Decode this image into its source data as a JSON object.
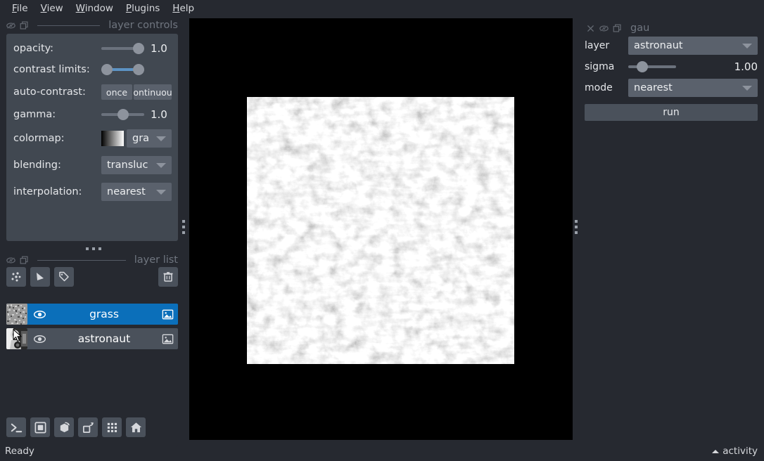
{
  "app": {
    "status": "Ready",
    "activity_label": "activity",
    "accent_selected": "#0b6fba",
    "panel_bg": "#414851",
    "window_bg": "#262930",
    "slider_fill": "#5c93c4"
  },
  "menubar": {
    "items": [
      {
        "label": "File",
        "mnemonic": "F"
      },
      {
        "label": "View",
        "mnemonic": "V"
      },
      {
        "label": "Window",
        "mnemonic": "W"
      },
      {
        "label": "Plugins",
        "mnemonic": "P"
      },
      {
        "label": "Help",
        "mnemonic": "H"
      }
    ]
  },
  "layer_controls": {
    "title": "layer controls",
    "opacity": {
      "label": "opacity:",
      "value": "1.00",
      "display": "1.0",
      "percent": 100
    },
    "contrast_limits": {
      "label": "contrast limits:",
      "low_percent": 0,
      "high_percent": 100
    },
    "auto_contrast": {
      "label": "auto-contrast:",
      "once_label": "once",
      "continuous_label": "continuous",
      "continuous_display": "ontinuou"
    },
    "gamma": {
      "label": "gamma:",
      "value": "1.00",
      "display": "1.0",
      "percent": 50
    },
    "colormap": {
      "label": "colormap:",
      "value": "gray",
      "display": "gra"
    },
    "blending": {
      "label": "blending:",
      "value": "translucent",
      "display": "transluc"
    },
    "interpolation": {
      "label": "interpolation:",
      "value": "nearest",
      "display": "nearest"
    }
  },
  "layer_list": {
    "title": "layer list",
    "buttons": [
      {
        "name": "new-points-layer",
        "tooltip": "New points layer"
      },
      {
        "name": "new-shapes-layer",
        "tooltip": "New shapes layer"
      },
      {
        "name": "new-labels-layer",
        "tooltip": "New labels layer"
      },
      {
        "name": "delete-layer",
        "tooltip": "Delete selected layers"
      }
    ],
    "layers": [
      {
        "name": "grass",
        "selected": true,
        "visible": true,
        "type": "image"
      },
      {
        "name": "astronaut",
        "selected": false,
        "visible": true,
        "type": "image"
      }
    ]
  },
  "viewer_buttons": [
    {
      "name": "console-button",
      "icon": "console-icon"
    },
    {
      "name": "ndisplay-button",
      "icon": "square-2d-icon"
    },
    {
      "name": "roll-dims-button",
      "icon": "cube-roll-icon"
    },
    {
      "name": "transpose-dims-button",
      "icon": "transpose-icon"
    },
    {
      "name": "grid-view-button",
      "icon": "grid-icon"
    },
    {
      "name": "home-button",
      "icon": "home-icon"
    }
  ],
  "plugin_dock": {
    "title": "gaussian_blur",
    "title_display": "gau",
    "layer": {
      "label": "layer",
      "value": "astronaut"
    },
    "sigma": {
      "label": "sigma",
      "value": "1.00",
      "percent": 20
    },
    "mode": {
      "label": "mode",
      "value": "nearest"
    },
    "run_label": "run"
  }
}
